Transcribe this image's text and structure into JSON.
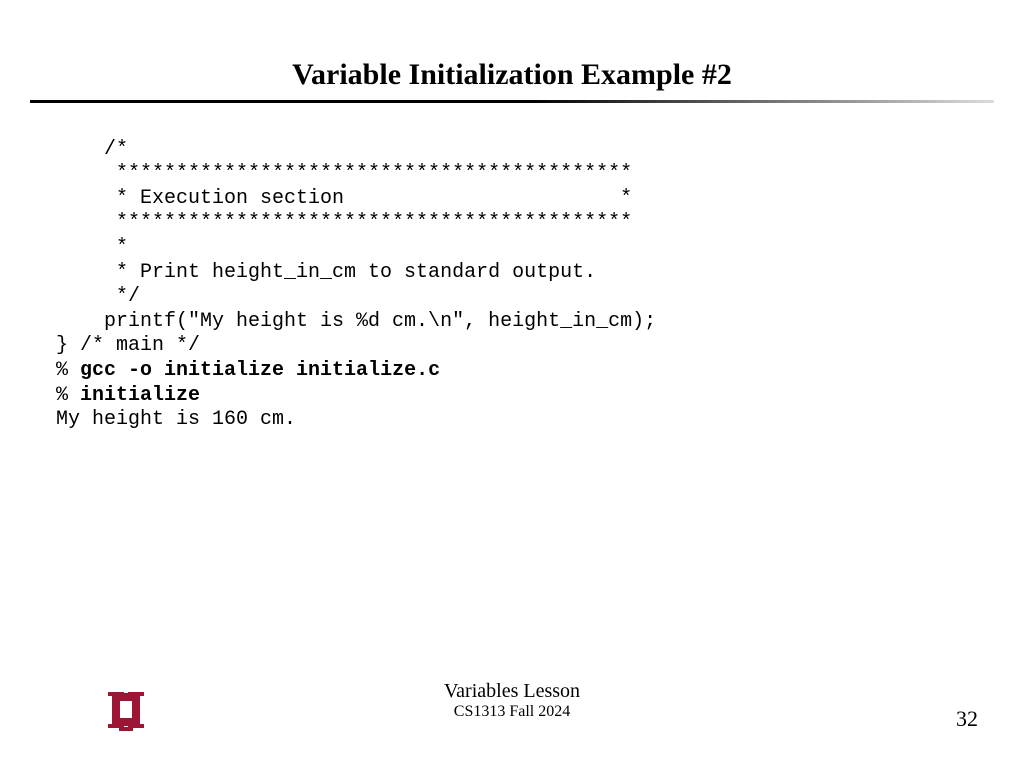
{
  "title": "Variable Initialization Example #2",
  "code": {
    "l01": "    /*",
    "l02": "     *******************************************",
    "l03": "     * Execution section                       *",
    "l04": "     *******************************************",
    "l05": "     *",
    "l06": "     * Print height_in_cm to standard output.",
    "l07": "     */",
    "l08": "    printf(\"My height is %d cm.\\n\", height_in_cm);",
    "l09": "} /* main */",
    "l10a": "% ",
    "l10b": "gcc -o initialize initialize.c",
    "l11a": "% ",
    "l11b": "initialize",
    "l12": "My height is 160 cm."
  },
  "footer": {
    "line1": "Variables Lesson",
    "line2": "CS1313 Fall 2024",
    "page": "32"
  },
  "logo": {
    "color": "#9d1535",
    "name": "ou-logo"
  }
}
